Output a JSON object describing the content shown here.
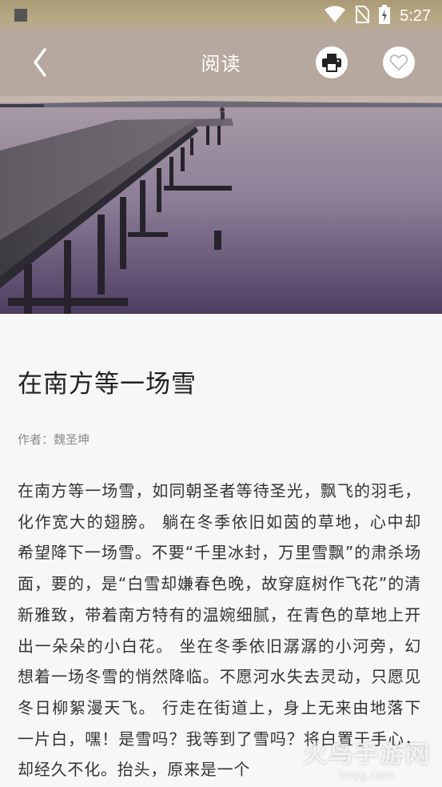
{
  "status_bar": {
    "time": "5:27",
    "icons": [
      "wifi-icon",
      "no-sim-icon",
      "battery-charging-icon"
    ]
  },
  "app_bar": {
    "title": "阅读",
    "back_icon": "chevron-left-icon",
    "print_icon": "print-icon",
    "favorite_icon": "heart-icon"
  },
  "article": {
    "title": "在南方等一场雪",
    "author": "作者：魏圣坤",
    "body": "在南方等一场雪，如同朝圣者等待圣光，飘飞的羽毛，化作宽大的翅膀。 躺在冬季依旧如茵的草地，心中却希望降下一场雪。不要“千里冰封，万里雪飘”的肃杀场面，要的，是“白雪却嫌春色晚，故穿庭树作飞花”的清新雅致，带着南方特有的温婉细腻，在青色的草地上开出一朵朵的小白花。 坐在冬季依旧潺潺的小河旁，幻想着一场冬雪的悄然降临。不愿河水失去灵动，只愿见冬日柳絮漫天飞。 行走在街道上，身上无来由地落下一片白，嘿！是雪吗？我等到了雪吗？将白置于手心，却经久不化。抬头，原来是一个"
  },
  "watermark": {
    "text": "火鸟手游网",
    "sub": "hnyg.com"
  }
}
